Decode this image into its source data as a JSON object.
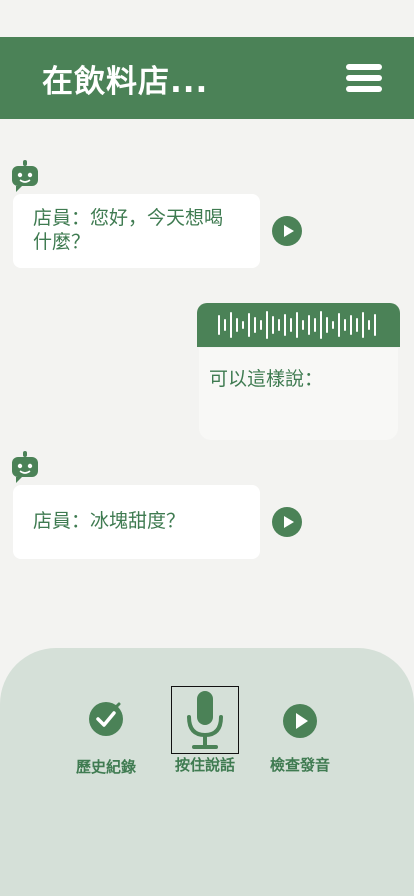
{
  "header": {
    "title": "在飲料店..."
  },
  "messages": [
    {
      "speaker": "bot",
      "text": "店員：您好，今天想喝什麼？"
    },
    {
      "speaker": "bot",
      "text": "店員：冰塊甜度？"
    }
  ],
  "suggestion": {
    "text": "可以這樣說："
  },
  "toolbar": {
    "history_label": "歷史紀錄",
    "hold_to_speak_label": "按住說話",
    "check_pronunciation_label": "檢查發音"
  },
  "colors": {
    "primary": "#4b8257",
    "background": "#f3f3f1",
    "panel": "#d5e0d8"
  }
}
